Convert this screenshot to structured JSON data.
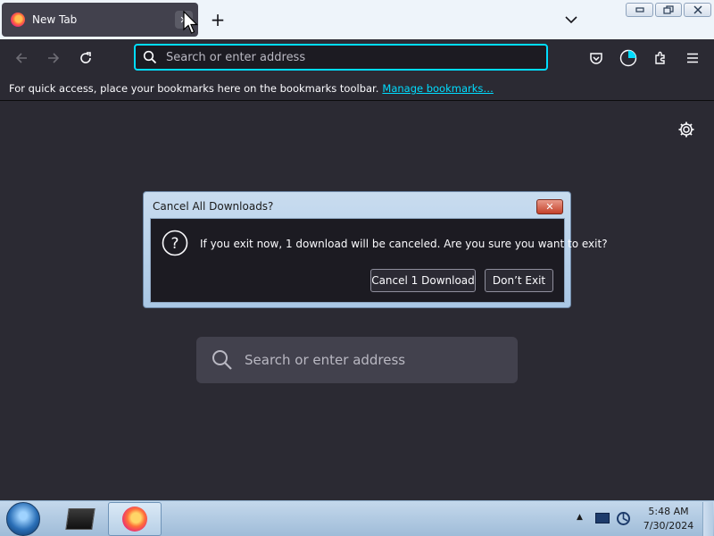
{
  "browser": {
    "tab": {
      "title": "New Tab",
      "close_glyph": "✕"
    },
    "new_tab_glyph": "+",
    "urlbar": {
      "placeholder": "Search or enter address",
      "value": ""
    },
    "bookmarks_bar": {
      "message": "For quick access, place your bookmarks here on the bookmarks toolbar.",
      "link": "Manage bookmarks…"
    },
    "content_search": {
      "placeholder": "Search or enter address"
    }
  },
  "dialog": {
    "title": "Cancel All Downloads?",
    "close_glyph": "✕",
    "message": "If you exit now, 1 download will be canceled. Are you sure you want to exit?",
    "buttons": {
      "cancel_download": "Cancel 1 Download",
      "dont_exit": "Don’t Exit"
    }
  },
  "taskbar": {
    "clock": {
      "time": "5:48 AM",
      "date": "7/30/2024"
    },
    "tray_chevron": "▲"
  },
  "colors": {
    "accent": "#00ddff",
    "page_bg": "#2b2a33",
    "tab_bg": "#42414d",
    "dialog_frame": "#b7d0ea",
    "taskbar": "#b4cde5"
  },
  "icons": [
    "firefox-icon",
    "close-icon",
    "plus-icon",
    "chevron-down-icon",
    "back-arrow-icon",
    "forward-arrow-icon",
    "reload-icon",
    "search-icon",
    "pocket-icon",
    "account-icon",
    "extensions-icon",
    "menu-icon",
    "gear-icon",
    "question-icon",
    "windows-start-icon",
    "network-icon",
    "sync-icon"
  ]
}
